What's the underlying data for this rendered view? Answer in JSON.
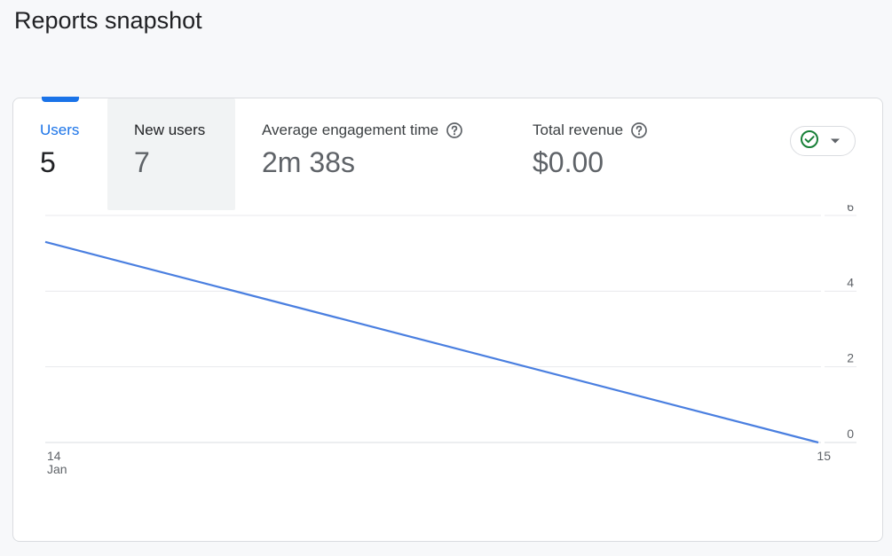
{
  "page": {
    "title": "Reports snapshot"
  },
  "metrics": {
    "users": {
      "label": "Users",
      "value": "5"
    },
    "new_users": {
      "label": "New users",
      "value": "7"
    },
    "engagement": {
      "label": "Average engagement time",
      "value": "2m 38s"
    },
    "revenue": {
      "label": "Total revenue",
      "value": "$0.00"
    }
  },
  "compare_dropdown": {
    "icon": "check-circle-icon",
    "caret": "caret-down-icon",
    "status_color": "#188038"
  },
  "colors": {
    "accent": "#1a73e8",
    "line": "#4a7fe0"
  },
  "chart_data": {
    "type": "line",
    "x": [
      "14 Jan",
      "15"
    ],
    "x_tick_labels": [
      [
        "14",
        "Jan"
      ],
      [
        "15"
      ]
    ],
    "series": [
      {
        "values": [
          5.3,
          0
        ]
      }
    ],
    "y_ticks": [
      "0",
      "2",
      "4",
      "6"
    ],
    "ylim": [
      0,
      6
    ],
    "y_axis_side": "right",
    "grid": true,
    "xlabel": "",
    "ylabel": "",
    "title": ""
  }
}
